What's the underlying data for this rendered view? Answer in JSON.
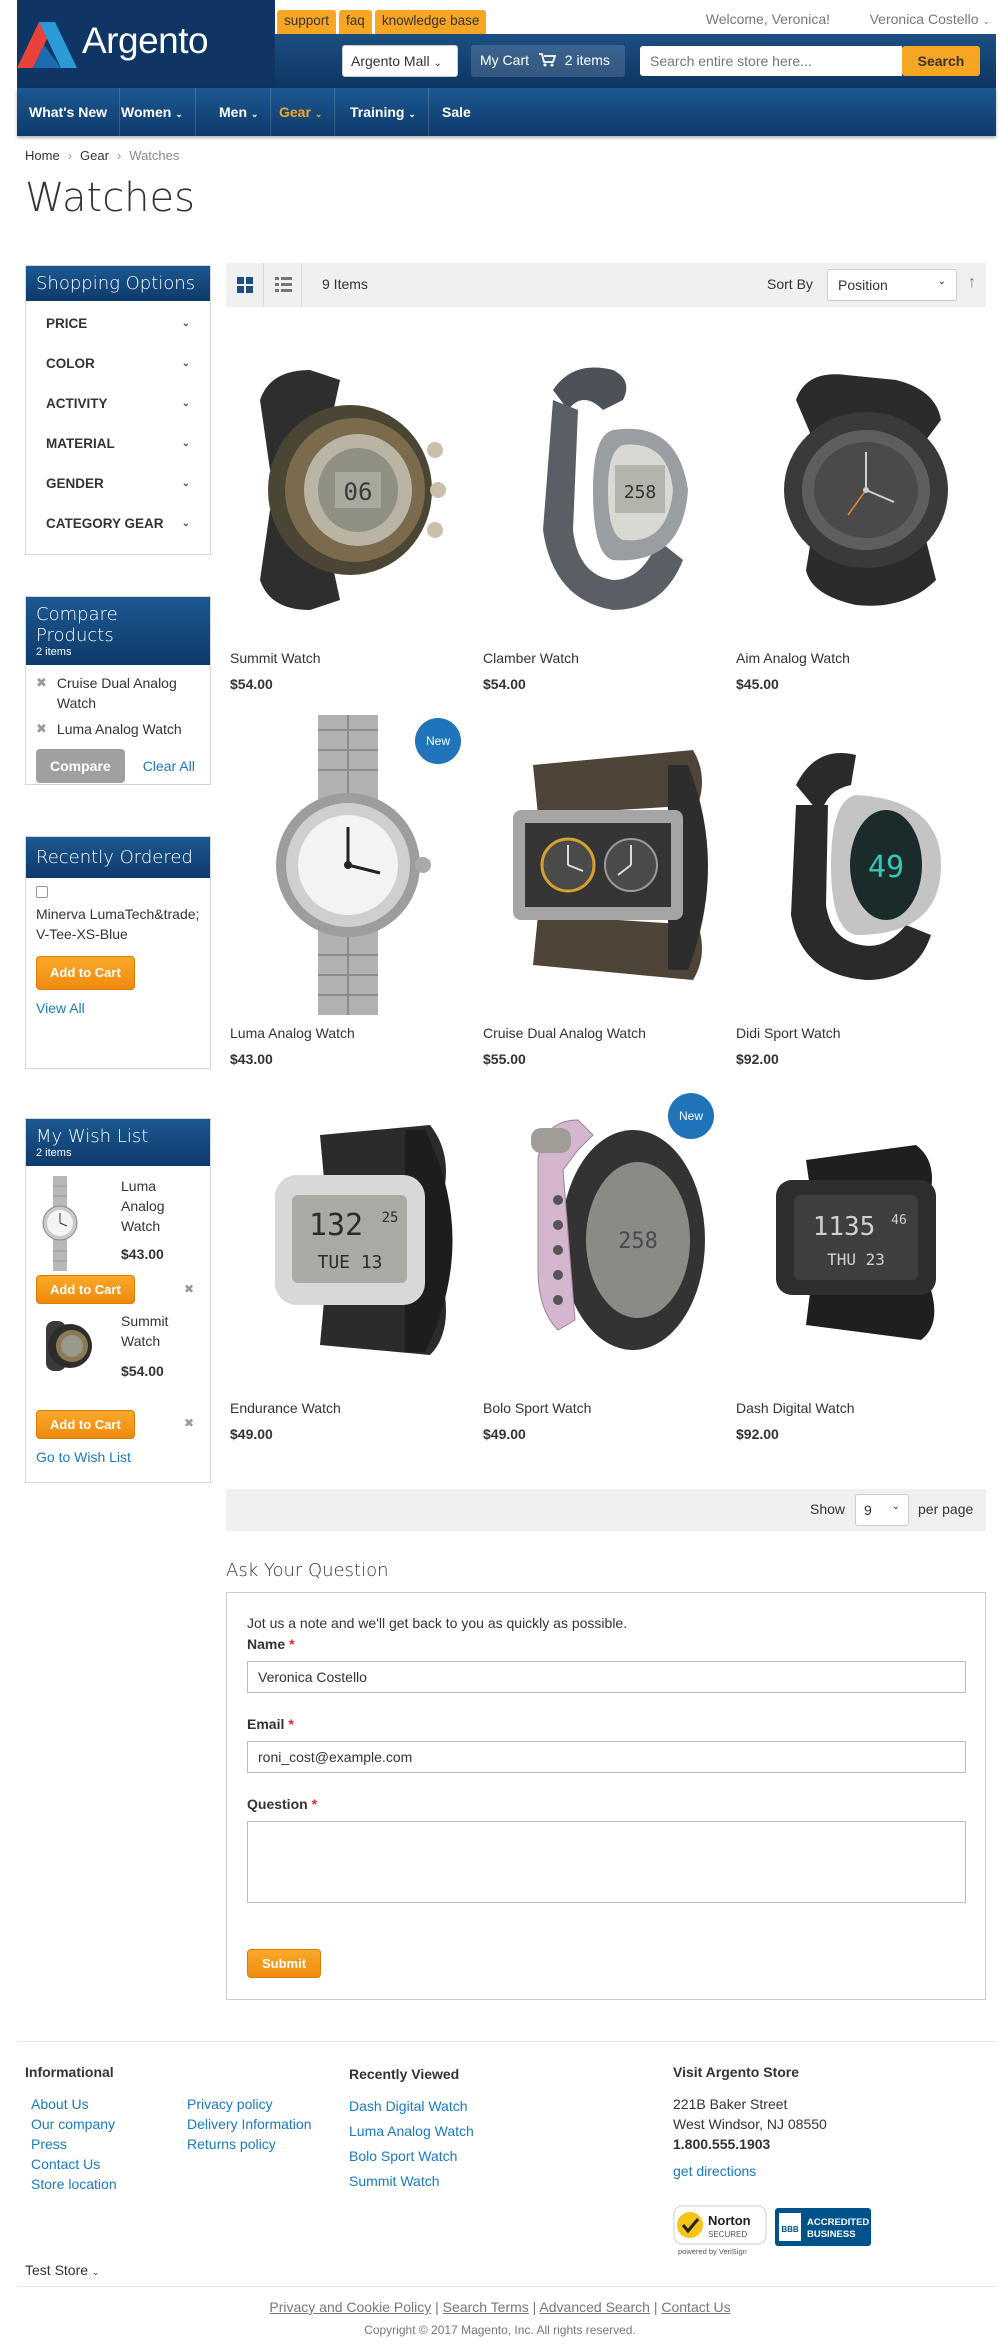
{
  "header": {
    "logo_text": "Argento",
    "top_links": [
      "support",
      "faq",
      "knowledge base"
    ],
    "welcome": "Welcome, Veronica!",
    "user": "Veronica Costello",
    "store_switcher": "Argento Mall",
    "cart_label": "My Cart",
    "cart_count": "2 items",
    "search_placeholder": "Search entire store here...",
    "search_button": "Search",
    "nav": [
      "What's New",
      "Women",
      "Men",
      "Gear",
      "Training",
      "Sale"
    ]
  },
  "breadcrumb": [
    "Home",
    "Gear",
    "Watches"
  ],
  "page_title": "Watches",
  "shopping_options": {
    "title": "Shopping Options",
    "filters": [
      "PRICE",
      "COLOR",
      "ACTIVITY",
      "MATERIAL",
      "GENDER",
      "CATEGORY GEAR"
    ]
  },
  "compare": {
    "title": "Compare Products",
    "count": "2 items",
    "items": [
      "Cruise Dual Analog Watch",
      "Luma Analog Watch"
    ],
    "compare_button": "Compare",
    "clear_all": "Clear All"
  },
  "recently_ordered": {
    "title": "Recently Ordered",
    "item": "Minerva LumaTech&trade; V-Tee-XS-Blue",
    "add_to_cart": "Add to Cart",
    "view_all": "View All"
  },
  "wishlist": {
    "title": "My Wish List",
    "count": "2 items",
    "items": [
      {
        "name": "Luma Analog Watch",
        "price": "$43.00"
      },
      {
        "name": "Summit Watch",
        "price": "$54.00"
      }
    ],
    "add_to_cart": "Add to Cart",
    "go_to": "Go to Wish List"
  },
  "toolbar": {
    "count": "9 Items",
    "sort_label": "Sort By",
    "sort_value": "Position",
    "show_label": "Show",
    "show_value": "9",
    "per_page": "per page"
  },
  "products": [
    {
      "name": "Summit Watch",
      "price": "$54.00",
      "new": false
    },
    {
      "name": "Clamber Watch",
      "price": "$54.00",
      "new": false
    },
    {
      "name": "Aim Analog Watch",
      "price": "$45.00",
      "new": false
    },
    {
      "name": "Luma Analog Watch",
      "price": "$43.00",
      "new": true
    },
    {
      "name": "Cruise Dual Analog Watch",
      "price": "$55.00",
      "new": false
    },
    {
      "name": "Didi Sport Watch",
      "price": "$92.00",
      "new": false
    },
    {
      "name": "Endurance Watch",
      "price": "$49.00",
      "new": false
    },
    {
      "name": "Bolo Sport Watch",
      "price": "$49.00",
      "new": true
    },
    {
      "name": "Dash Digital Watch",
      "price": "$92.00",
      "new": false
    }
  ],
  "new_badge": "New",
  "watch_faces": {
    "summit": "06",
    "clamber": "258",
    "didi": "49",
    "endurance_time": "132",
    "endurance_sec": "25",
    "endurance_date": "TUE 13",
    "bolo": "258",
    "dash_time": "1135",
    "dash_sec": "46",
    "dash_date": "THU 23"
  },
  "ask": {
    "title": "Ask Your Question",
    "intro": "Jot us a note and we'll get back to you as quickly as possible.",
    "name_label": "Name",
    "name_value": "Veronica Costello",
    "email_label": "Email",
    "email_value": "roni_cost@example.com",
    "question_label": "Question",
    "submit": "Submit",
    "required_mark": "*"
  },
  "footer": {
    "informational_title": "Informational",
    "info_col1": [
      "About Us",
      "Our company",
      "Press",
      "Contact Us",
      "Store location"
    ],
    "info_col2": [
      "Privacy policy",
      "Delivery Information",
      "Returns policy"
    ],
    "recent_title": "Recently Viewed",
    "recent": [
      "Dash Digital Watch",
      "Luma Analog Watch",
      "Bolo Sport Watch",
      "Summit Watch"
    ],
    "store_title": "Visit Argento Store",
    "address1": "221B Baker Street",
    "address2": "West Windsor, NJ 08550",
    "phone": "1.800.555.1903",
    "directions": "get directions",
    "norton_top": "Norton",
    "norton_mid": "SECURED",
    "norton_bottom": "powered by VeriSign",
    "bbb_text1": "ACCREDITED",
    "bbb_text2": "BUSINESS",
    "bbb_logo": "BBB",
    "store_switch": "Test Store",
    "bottom_links": [
      "Privacy and Cookie Policy",
      "Search Terms",
      "Advanced Search",
      "Contact Us"
    ],
    "copyright": "Copyright © 2017 Magento, Inc. All rights reserved."
  },
  "colors": {
    "brand_blue": "#0e3563",
    "accent_orange": "#f6a623",
    "link": "#1979c3"
  }
}
